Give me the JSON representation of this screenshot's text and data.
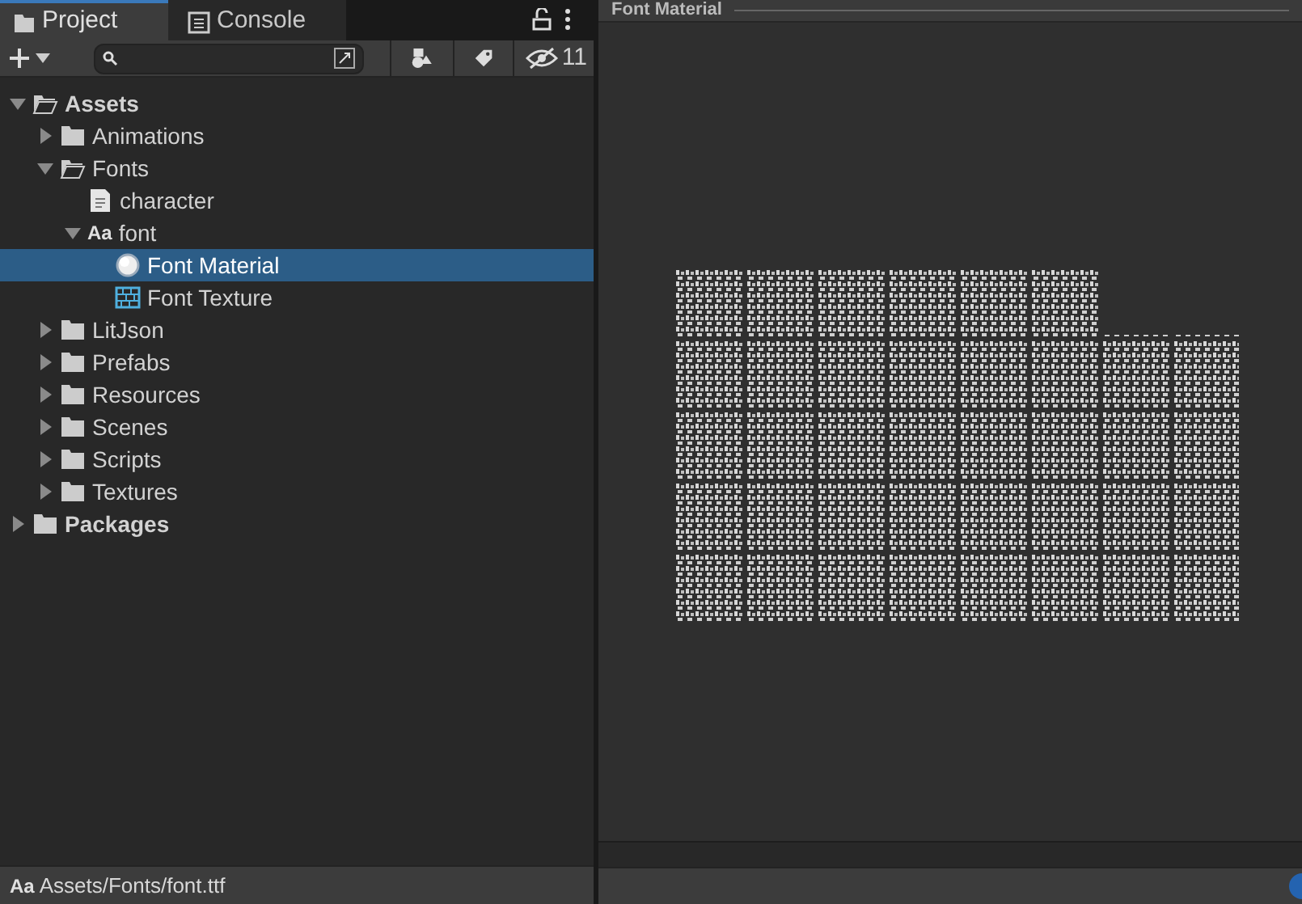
{
  "tabs": [
    {
      "label": "Project",
      "selected": true
    },
    {
      "label": "Console",
      "selected": false
    }
  ],
  "toolbar": {
    "hidden_count": "11"
  },
  "tree": [
    {
      "label": "Assets",
      "kind": "folder",
      "bold": true,
      "expanded": true,
      "selected": false,
      "children": [
        {
          "label": "Animations",
          "kind": "folder",
          "expanded": false,
          "selected": false
        },
        {
          "label": "Fonts",
          "kind": "folder",
          "expanded": true,
          "selected": false,
          "children": [
            {
              "label": "character",
              "kind": "text",
              "selected": false
            },
            {
              "label": "font",
              "kind": "font",
              "icon_text": "Aa",
              "expanded": true,
              "selected": false,
              "children": [
                {
                  "label": "Font Material",
                  "kind": "material",
                  "selected": true
                },
                {
                  "label": "Font Texture",
                  "kind": "texture",
                  "selected": false
                }
              ]
            }
          ]
        },
        {
          "label": "LitJson",
          "kind": "folder",
          "expanded": false,
          "selected": false
        },
        {
          "label": "Prefabs",
          "kind": "folder",
          "expanded": false,
          "selected": false
        },
        {
          "label": "Resources",
          "kind": "folder",
          "expanded": false,
          "selected": false
        },
        {
          "label": "Scenes",
          "kind": "folder",
          "expanded": false,
          "selected": false
        },
        {
          "label": "Scripts",
          "kind": "folder",
          "expanded": false,
          "selected": false
        },
        {
          "label": "Textures",
          "kind": "folder",
          "expanded": false,
          "selected": false
        }
      ]
    },
    {
      "label": "Packages",
      "kind": "folder",
      "bold": true,
      "expanded": false,
      "selected": false
    }
  ],
  "status_bar": {
    "icon_text": "Aa",
    "path": "Assets/Fonts/font.ttf"
  },
  "preview": {
    "title": "Font Material"
  }
}
